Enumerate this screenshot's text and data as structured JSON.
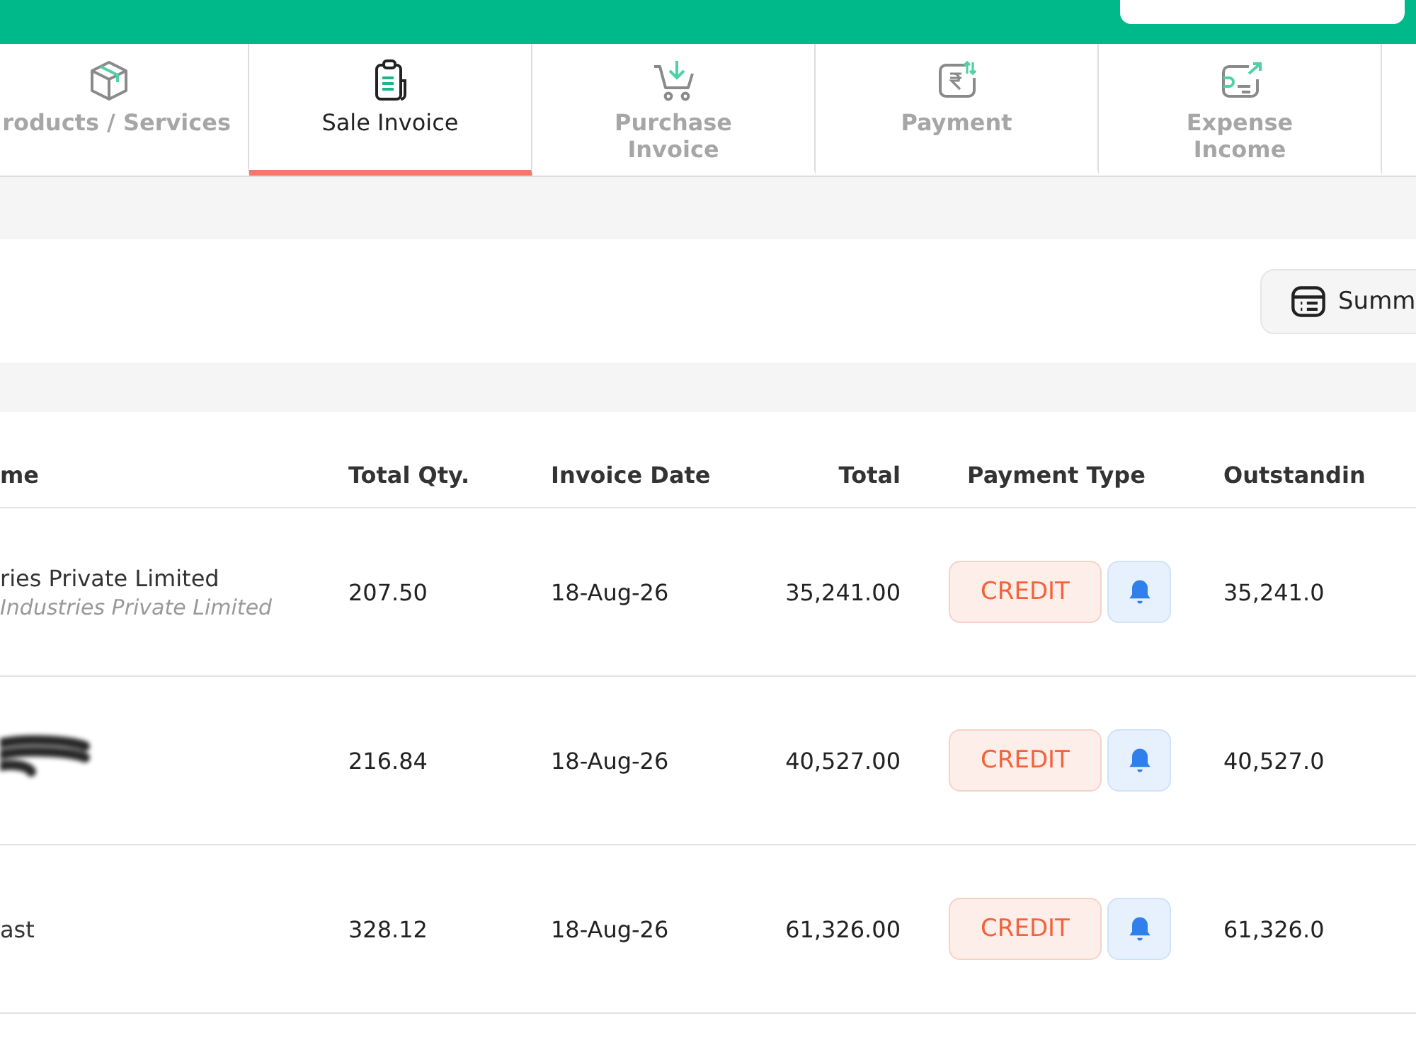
{
  "tabs": [
    {
      "label": "roducts / Services",
      "kind": "box",
      "selected": false
    },
    {
      "label": "Sale Invoice",
      "kind": "clipboard",
      "selected": true
    },
    {
      "label": "Purchase Invoice",
      "kind": "cart",
      "selected": false
    },
    {
      "label": "Payment",
      "kind": "rupee",
      "selected": false
    },
    {
      "label": "Expense Income",
      "kind": "card",
      "selected": false
    }
  ],
  "summary_button": {
    "label": "Summ"
  },
  "table": {
    "columns": [
      "me",
      "Total Qty.",
      "Invoice Date",
      "Total",
      "Payment Type",
      "Outstandin"
    ],
    "rows": [
      {
        "name": "ries Private Limited",
        "subtitle": "Industries Private Limited",
        "redacted": false,
        "qty": "207.50",
        "date": "18-Aug-26",
        "total": "35,241.00",
        "payment_type": "CREDIT",
        "outstanding": "35,241.0"
      },
      {
        "redacted": true,
        "qty": "216.84",
        "date": "18-Aug-26",
        "total": "40,527.00",
        "payment_type": "CREDIT",
        "outstanding": "40,527.0"
      },
      {
        "name": "ast",
        "redacted": false,
        "qty": "328.12",
        "date": "18-Aug-26",
        "total": "61,326.00",
        "payment_type": "CREDIT",
        "outstanding": "61,326.0"
      }
    ]
  }
}
